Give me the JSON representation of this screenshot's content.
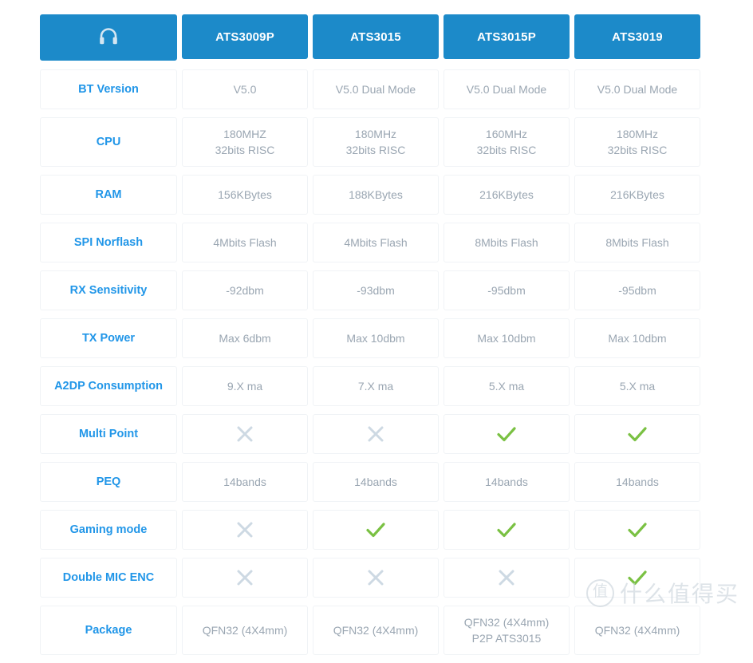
{
  "table": {
    "header": {
      "label_icon": "headphone-icon",
      "columns": [
        "ATS3009P",
        "ATS3015",
        "ATS3015P",
        "ATS3019"
      ]
    },
    "rows": [
      {
        "label": "BT Version",
        "tall": false,
        "values": [
          {
            "type": "text",
            "text": "V5.0"
          },
          {
            "type": "text",
            "text": "V5.0 Dual Mode"
          },
          {
            "type": "text",
            "text": "V5.0 Dual Mode"
          },
          {
            "type": "text",
            "text": "V5.0 Dual Mode"
          }
        ]
      },
      {
        "label": "CPU",
        "tall": true,
        "values": [
          {
            "type": "text",
            "text": "180MHZ\n32bits RISC"
          },
          {
            "type": "text",
            "text": "180MHz\n32bits RISC"
          },
          {
            "type": "text",
            "text": "160MHz\n32bits RISC"
          },
          {
            "type": "text",
            "text": "180MHz\n32bits RISC"
          }
        ]
      },
      {
        "label": "RAM",
        "tall": false,
        "values": [
          {
            "type": "text",
            "text": "156KBytes"
          },
          {
            "type": "text",
            "text": "188KBytes"
          },
          {
            "type": "text",
            "text": "216KBytes"
          },
          {
            "type": "text",
            "text": "216KBytes"
          }
        ]
      },
      {
        "label": "SPI Norflash",
        "tall": false,
        "values": [
          {
            "type": "text",
            "text": "4Mbits Flash"
          },
          {
            "type": "text",
            "text": "4Mbits Flash"
          },
          {
            "type": "text",
            "text": "8Mbits Flash"
          },
          {
            "type": "text",
            "text": "8Mbits Flash"
          }
        ]
      },
      {
        "label": "RX Sensitivity",
        "tall": false,
        "values": [
          {
            "type": "text",
            "text": "-92dbm"
          },
          {
            "type": "text",
            "text": "-93dbm"
          },
          {
            "type": "text",
            "text": "-95dbm"
          },
          {
            "type": "text",
            "text": "-95dbm"
          }
        ]
      },
      {
        "label": "TX Power",
        "tall": false,
        "values": [
          {
            "type": "text",
            "text": "Max 6dbm"
          },
          {
            "type": "text",
            "text": "Max 10dbm"
          },
          {
            "type": "text",
            "text": "Max 10dbm"
          },
          {
            "type": "text",
            "text": "Max 10dbm"
          }
        ]
      },
      {
        "label": "A2DP Consumption",
        "tall": false,
        "values": [
          {
            "type": "text",
            "text": "9.X ma"
          },
          {
            "type": "text",
            "text": "7.X ma"
          },
          {
            "type": "text",
            "text": "5.X ma"
          },
          {
            "type": "text",
            "text": "5.X ma"
          }
        ]
      },
      {
        "label": "Multi Point",
        "tall": false,
        "values": [
          {
            "type": "cross",
            "text": ""
          },
          {
            "type": "cross",
            "text": ""
          },
          {
            "type": "check",
            "text": ""
          },
          {
            "type": "check",
            "text": ""
          }
        ]
      },
      {
        "label": "PEQ",
        "tall": false,
        "values": [
          {
            "type": "text",
            "text": "14bands"
          },
          {
            "type": "text",
            "text": "14bands"
          },
          {
            "type": "text",
            "text": "14bands"
          },
          {
            "type": "text",
            "text": "14bands"
          }
        ]
      },
      {
        "label": "Gaming mode",
        "tall": false,
        "values": [
          {
            "type": "cross",
            "text": ""
          },
          {
            "type": "check",
            "text": ""
          },
          {
            "type": "check",
            "text": ""
          },
          {
            "type": "check",
            "text": ""
          }
        ]
      },
      {
        "label": "Double MIC ENC",
        "tall": false,
        "values": [
          {
            "type": "cross",
            "text": ""
          },
          {
            "type": "cross",
            "text": ""
          },
          {
            "type": "cross",
            "text": ""
          },
          {
            "type": "check",
            "text": ""
          }
        ]
      },
      {
        "label": "Package",
        "tall": true,
        "values": [
          {
            "type": "text",
            "text": "QFN32 (4X4mm)"
          },
          {
            "type": "text",
            "text": "QFN32 (4X4mm)"
          },
          {
            "type": "text",
            "text": "QFN32 (4X4mm)\nP2P ATS3015"
          },
          {
            "type": "text",
            "text": "QFN32 (4X4mm)"
          }
        ]
      }
    ]
  },
  "watermark": {
    "badge": "值",
    "text": "什么值得买"
  },
  "colors": {
    "header_blue": "#1c8ac9",
    "label_blue": "#2196e8",
    "value_gray": "#9aa6b2",
    "check_green": "#7ac143",
    "cross_gray": "#cdd9e3"
  }
}
